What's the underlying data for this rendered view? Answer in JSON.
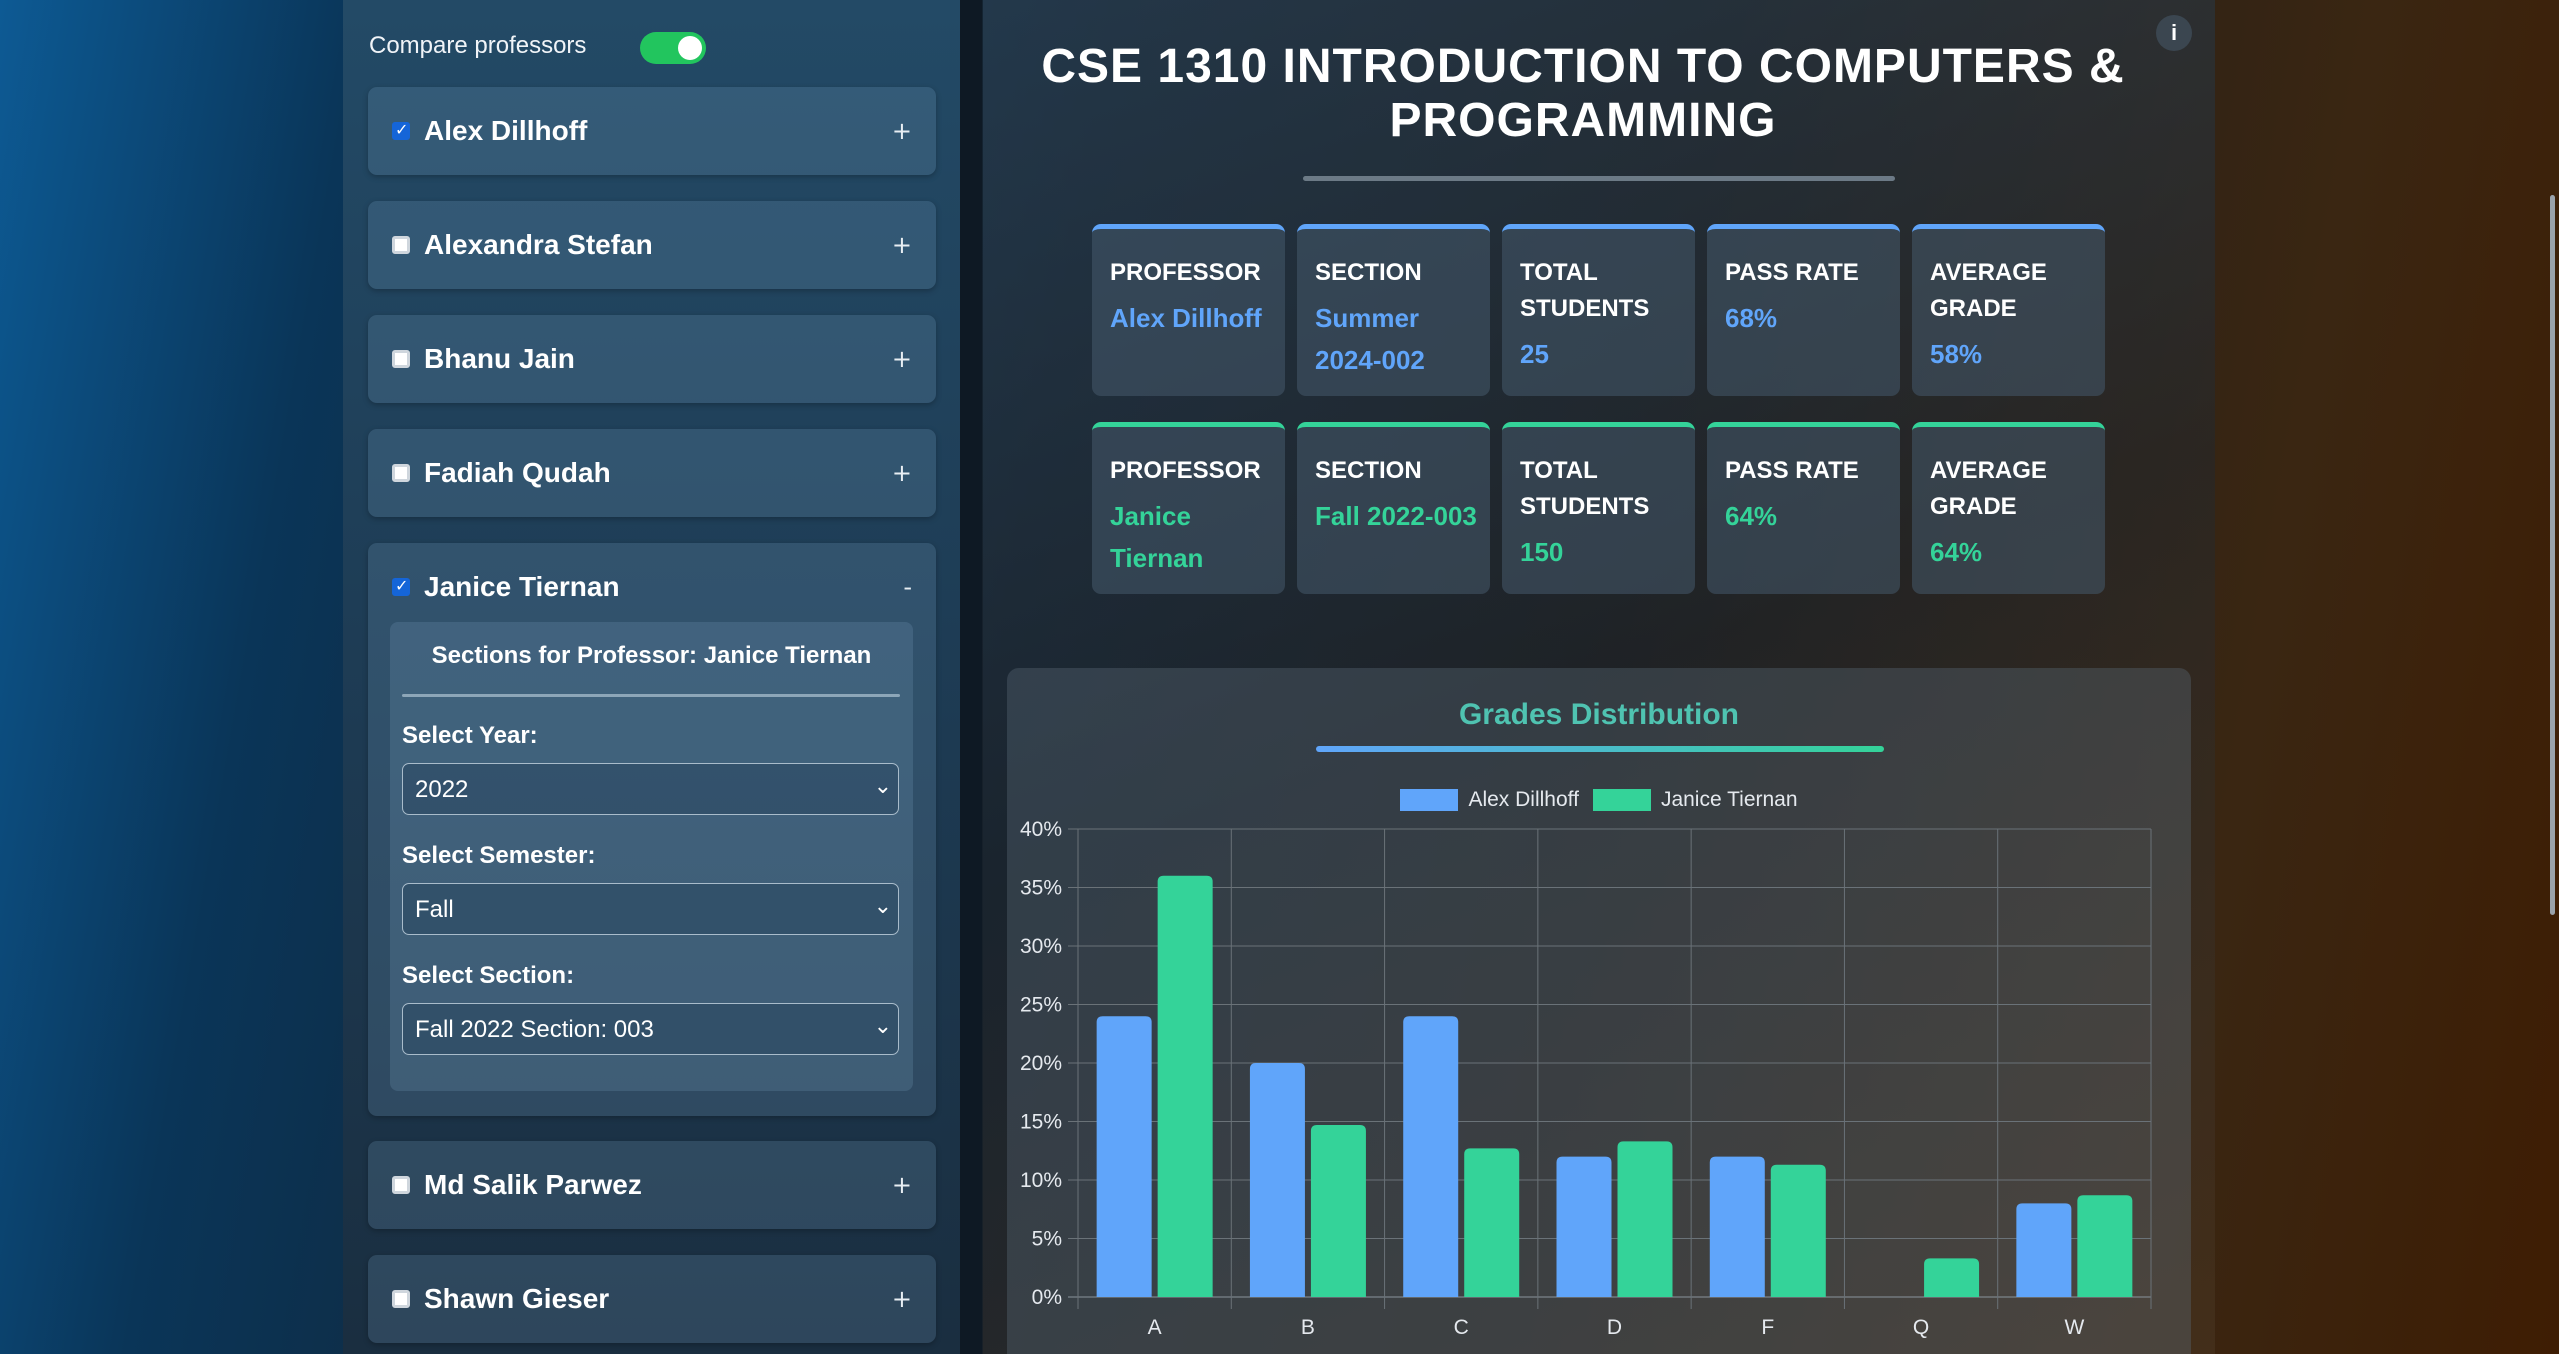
{
  "sidebar": {
    "compare_label": "Compare professors",
    "compare_enabled": true,
    "professors": [
      {
        "name": "Alex Dillhoff",
        "checked": true,
        "expanded": false,
        "toggle": "+"
      },
      {
        "name": "Alexandra Stefan",
        "checked": false,
        "expanded": false,
        "toggle": "+"
      },
      {
        "name": "Bhanu Jain",
        "checked": false,
        "expanded": false,
        "toggle": "+"
      },
      {
        "name": "Fadiah Qudah",
        "checked": false,
        "expanded": false,
        "toggle": "+"
      },
      {
        "name": "Janice Tiernan",
        "checked": true,
        "expanded": true,
        "toggle": "-"
      },
      {
        "name": "Md Salik Parwez",
        "checked": false,
        "expanded": false,
        "toggle": "+"
      },
      {
        "name": "Shawn Gieser",
        "checked": false,
        "expanded": false,
        "toggle": "+"
      }
    ],
    "sections_panel": {
      "title": "Sections for Professor: Janice Tiernan",
      "year_label": "Select Year:",
      "year_value": "2022",
      "semester_label": "Select Semester:",
      "semester_value": "Fall",
      "section_label": "Select Section:",
      "section_value": "Fall 2022 Section: 003"
    }
  },
  "main": {
    "info_label": "i",
    "course_title": "CSE 1310 INTRODUCTION TO COMPUTERS & PROGRAMMING",
    "stat_rows": [
      {
        "accent": "#60a5fa",
        "cards": [
          {
            "label": "PROFESSOR",
            "value": "Alex Dillhoff"
          },
          {
            "label": "SECTION",
            "value": "Summer 2024-002"
          },
          {
            "label": "TOTAL STUDENTS",
            "value": "25"
          },
          {
            "label": "PASS RATE",
            "value": "68%"
          },
          {
            "label": "AVERAGE GRADE",
            "value": "58%"
          }
        ]
      },
      {
        "accent": "#34d399",
        "cards": [
          {
            "label": "PROFESSOR",
            "value": "Janice Tiernan"
          },
          {
            "label": "SECTION",
            "value": "Fall 2022-003"
          },
          {
            "label": "TOTAL STUDENTS",
            "value": "150"
          },
          {
            "label": "PASS RATE",
            "value": "64%"
          },
          {
            "label": "AVERAGE GRADE",
            "value": "64%"
          }
        ]
      }
    ]
  },
  "colors": {
    "blue": "#60a5fa",
    "green": "#34d399",
    "title_teal": "#4fc3b1",
    "toggle_on": "#22c55e"
  },
  "chart_data": {
    "type": "bar",
    "title": "Grades Distribution",
    "categories": [
      "A",
      "B",
      "C",
      "D",
      "F",
      "Q",
      "W"
    ],
    "series": [
      {
        "name": "Alex Dillhoff",
        "color": "#60a5fa",
        "values": [
          24,
          20,
          24,
          12,
          12,
          0,
          8
        ]
      },
      {
        "name": "Janice Tiernan",
        "color": "#34d399",
        "values": [
          36,
          14.7,
          12.7,
          13.3,
          11.3,
          3.3,
          8.7
        ]
      }
    ],
    "ylim": [
      0,
      40
    ],
    "yticks": [
      "0%",
      "5%",
      "10%",
      "15%",
      "20%",
      "25%",
      "30%",
      "35%",
      "40%"
    ],
    "ytick_values": [
      0,
      5,
      10,
      15,
      20,
      25,
      30,
      35,
      40
    ],
    "grid": true,
    "legend": "top-center"
  }
}
